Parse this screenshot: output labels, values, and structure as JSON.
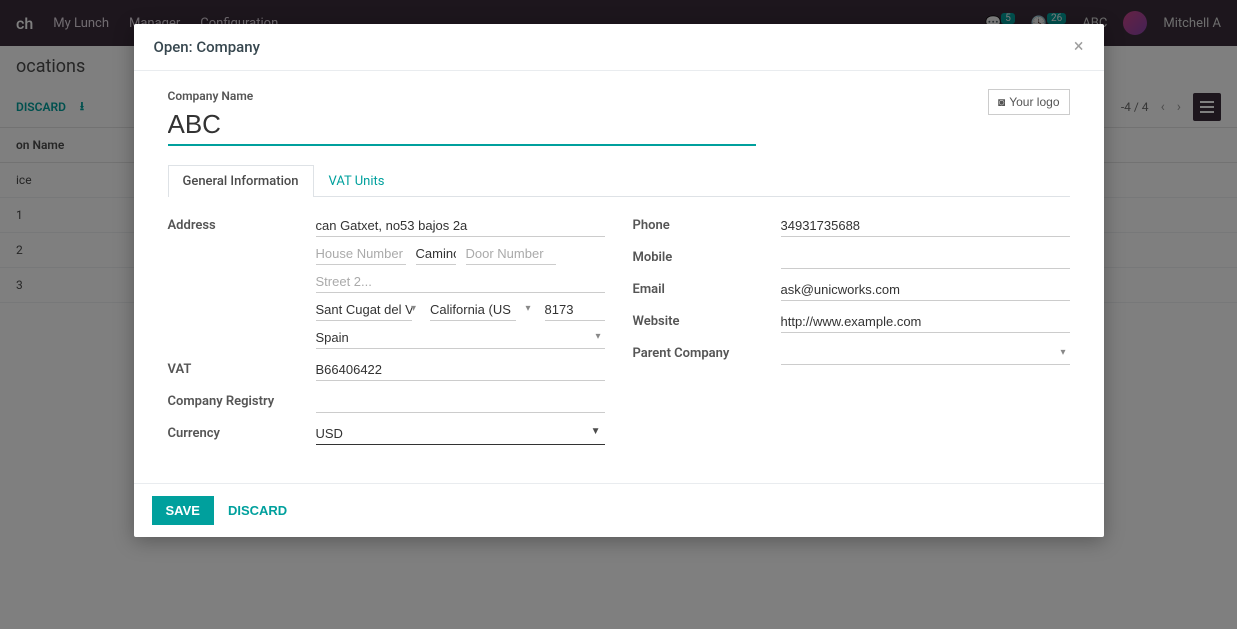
{
  "topbar": {
    "brand_suffix": "ch",
    "items": [
      "My Lunch",
      "Manager",
      "Configuration"
    ],
    "badge1": "5",
    "badge2": "26",
    "company_short": "ABC",
    "user_name": "Mitchell A"
  },
  "bg": {
    "title_suffix": "ocations",
    "discard": "DISCARD",
    "col_header_suffix": "on Name",
    "rows": [
      "ice",
      "1",
      "2",
      "3"
    ],
    "pager": "-4 / 4"
  },
  "modal": {
    "title": "Open: Company",
    "logo_btn": "Your logo",
    "company_name_label": "Company Name",
    "company_name": "ABC",
    "tabs": {
      "general": "General Information",
      "vat": "VAT Units"
    },
    "left": {
      "address_label": "Address",
      "street": "can Gatxet, no53 bajos 2a",
      "house_ph": "House Number",
      "street_name": "Camino",
      "door_ph": "Door Number",
      "street2_ph": "Street 2...",
      "city": "Sant Cugat del Va",
      "state": "California (US",
      "zip": "8173",
      "country": "Spain",
      "vat_label": "VAT",
      "vat": "B66406422",
      "registry_label": "Company Registry",
      "registry": "",
      "currency_label": "Currency",
      "currency": "USD"
    },
    "right": {
      "phone_label": "Phone",
      "phone": "34931735688",
      "mobile_label": "Mobile",
      "mobile": "",
      "email_label": "Email",
      "email": "ask@unicworks.com",
      "website_label": "Website",
      "website": "http://www.example.com",
      "parent_label": "Parent Company",
      "parent": ""
    },
    "footer": {
      "save": "SAVE",
      "discard": "DISCARD"
    }
  }
}
